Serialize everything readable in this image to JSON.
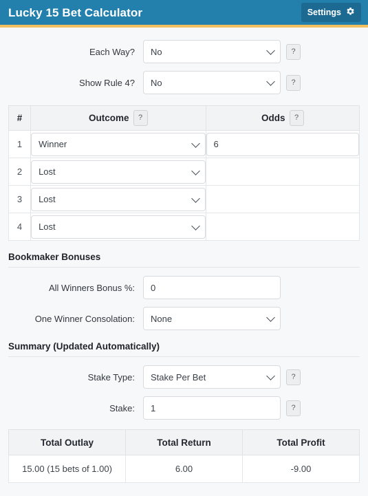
{
  "header": {
    "title": "Lucky 15 Bet Calculator",
    "settings_label": "Settings",
    "settings_icon": "gear-icon",
    "bar_color": "#2380ad",
    "accent_color": "#f0c060",
    "button_color": "#1c6a91"
  },
  "options": {
    "each_way": {
      "label": "Each Way?",
      "value": "No",
      "help": "?"
    },
    "show_rule4": {
      "label": "Show Rule 4?",
      "value": "No",
      "help": "?"
    }
  },
  "bet_table": {
    "headers": {
      "num": "#",
      "outcome": "Outcome",
      "odds": "Odds"
    },
    "outcome_help": "?",
    "odds_help": "?",
    "rows": [
      {
        "num": "1",
        "outcome": "Winner",
        "odds": "6"
      },
      {
        "num": "2",
        "outcome": "Lost",
        "odds": ""
      },
      {
        "num": "3",
        "outcome": "Lost",
        "odds": ""
      },
      {
        "num": "4",
        "outcome": "Lost",
        "odds": ""
      }
    ]
  },
  "bonuses": {
    "heading": "Bookmaker Bonuses",
    "all_winners_bonus": {
      "label": "All Winners Bonus %:",
      "value": "0"
    },
    "one_winner_consolation": {
      "label": "One Winner Consolation:",
      "value": "None"
    }
  },
  "summary": {
    "heading": "Summary (Updated Automatically)",
    "stake_type": {
      "label": "Stake Type:",
      "value": "Stake Per Bet",
      "help": "?"
    },
    "stake": {
      "label": "Stake:",
      "value": "1",
      "help": "?"
    }
  },
  "totals": {
    "headers": [
      "Total Outlay",
      "Total Return",
      "Total Profit"
    ],
    "values": [
      "15.00 (15 bets of 1.00)",
      "6.00",
      "-9.00"
    ]
  }
}
